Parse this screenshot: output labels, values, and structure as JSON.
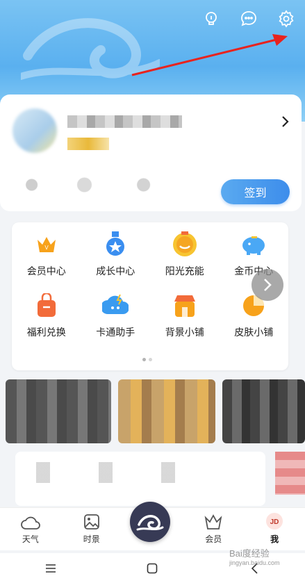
{
  "header": {
    "icons": [
      "lightbulb-icon",
      "chat-icon",
      "settings-gear-icon"
    ]
  },
  "profile": {
    "checkin_label": "签到"
  },
  "services": [
    {
      "label": "会员中心",
      "icon": "crown-icon",
      "color": "#f7a21b"
    },
    {
      "label": "成长中心",
      "icon": "medal-icon",
      "color": "#3a8ef0"
    },
    {
      "label": "阳光充能",
      "icon": "sun-icon",
      "color": "#f5a623"
    },
    {
      "label": "金币中心",
      "icon": "piggy-bank-icon",
      "color": "#4aa8f5"
    },
    {
      "label": "福利兑换",
      "icon": "gift-bag-icon",
      "color": "#f26b3a"
    },
    {
      "label": "卡通助手",
      "icon": "cartoon-assistant-icon",
      "color": "#3a9bf0"
    },
    {
      "label": "背景小铺",
      "icon": "shop-icon",
      "color": "#f5a623"
    },
    {
      "label": "皮肤小铺",
      "icon": "pie-chart-icon",
      "color": "#f5a623"
    }
  ],
  "tabbar": {
    "items": [
      {
        "label": "天气",
        "icon": "cloud-icon"
      },
      {
        "label": "时景",
        "icon": "picture-icon"
      },
      {
        "label": "",
        "icon": "cloud-logo-icon"
      },
      {
        "label": "会员",
        "icon": "crown-icon"
      },
      {
        "label": "我",
        "icon": "avatar-icon",
        "active": true
      }
    ]
  },
  "watermark": {
    "title": "Bai度经验",
    "url": "jingyan.baidu.com"
  }
}
